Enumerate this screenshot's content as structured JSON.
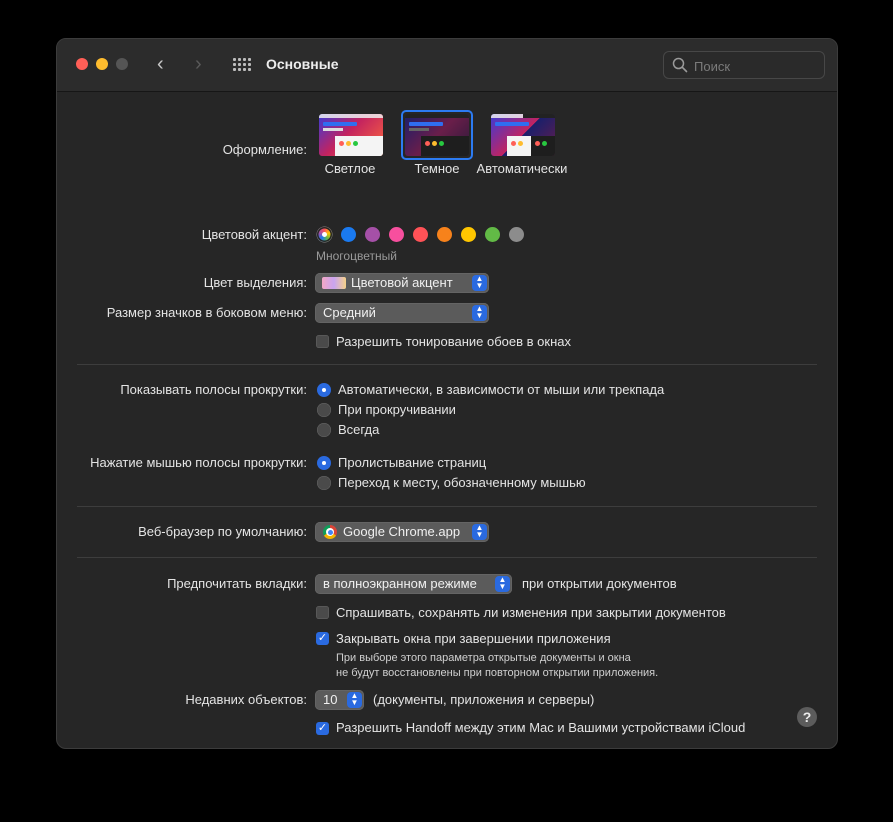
{
  "window": {
    "title": "Основные"
  },
  "search": {
    "placeholder": "Поиск"
  },
  "appearance": {
    "label": "Оформление:",
    "options": [
      {
        "name": "Светлое",
        "selected": false
      },
      {
        "name": "Темное",
        "selected": true
      },
      {
        "name": "Автоматически",
        "selected": false
      }
    ]
  },
  "accent": {
    "label": "Цветовой акцент:",
    "selected_name": "Многоцветный",
    "colors": [
      "multicolor",
      "#1a7af0",
      "#a550a7",
      "#f74f9e",
      "#ff5257",
      "#f7821b",
      "#ffc600",
      "#62ba46",
      "#8c8c8c"
    ]
  },
  "highlight": {
    "label": "Цвет выделения:",
    "value": "Цветовой акцент"
  },
  "sidebar_icon_size": {
    "label": "Размер значков в боковом меню:",
    "value": "Средний"
  },
  "wallpaper_tinting": {
    "label": "Разрешить тонирование обоев в окнах",
    "checked": false
  },
  "show_scrollbars": {
    "label": "Показывать полосы прокрутки:",
    "options": [
      {
        "label": "Автоматически, в зависимости от мыши или трекпада",
        "selected": true
      },
      {
        "label": "При прокручивании",
        "selected": false
      },
      {
        "label": "Всегда",
        "selected": false
      }
    ]
  },
  "click_scrollbar": {
    "label": "Нажатие мышью полосы прокрутки:",
    "options": [
      {
        "label": "Пролистывание страниц",
        "selected": true
      },
      {
        "label": "Переход к месту, обозначенному мышью",
        "selected": false
      }
    ]
  },
  "default_browser": {
    "label": "Веб-браузер по умолчанию:",
    "value": "Google Chrome.app"
  },
  "prefer_tabs": {
    "label": "Предпочитать вкладки:",
    "value": "в полноэкранном режиме",
    "suffix": "при открытии документов"
  },
  "ask_keep_changes": {
    "label": "Спрашивать, сохранять ли изменения при закрытии документов",
    "checked": false
  },
  "close_windows": {
    "label": "Закрывать окна при завершении приложения",
    "checked": true,
    "note_line1": "При выборе этого параметра открытые документы и окна",
    "note_line2": "не будут восстановлены при повторном открытии приложения."
  },
  "recent_items": {
    "label": "Недавних объектов:",
    "value": "10",
    "suffix": "(документы, приложения и серверы)"
  },
  "handoff": {
    "label": "Разрешить Handoff между этим Mac и Вашими устройствами iCloud",
    "checked": true
  },
  "help": {
    "label": "?"
  }
}
